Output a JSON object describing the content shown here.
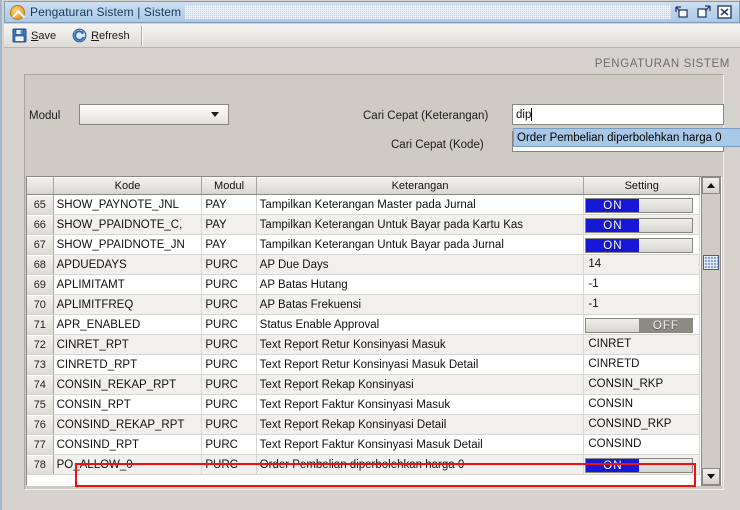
{
  "window": {
    "title": "Pengaturan Sistem | Sistem",
    "icon": "app-chevron-icon",
    "controls": [
      {
        "name": "restore-button",
        "label": "Restore"
      },
      {
        "name": "maximize-button",
        "label": "Maximize"
      },
      {
        "name": "close-button",
        "label": "Close"
      }
    ]
  },
  "toolbar": {
    "items": [
      {
        "name": "save-button",
        "label": "Save",
        "mnemonic": "S",
        "icon": "floppy-disk-icon"
      },
      {
        "name": "refresh-button",
        "label": "Refresh",
        "mnemonic": "R",
        "icon": "refresh-circle-icon"
      }
    ]
  },
  "page": {
    "title": "PENGATURAN SISTEM"
  },
  "form": {
    "modul_label": "Modul",
    "modul_value": "",
    "cari_ket_label": "Cari Cepat (Keterangan)",
    "cari_ket_value": "dip",
    "cari_kode_label": "Cari Cepat (Kode)",
    "cari_kode_value": "",
    "autocomplete_suggestion": "Order Pembelian diperbolehkan harga 0"
  },
  "table": {
    "columns": [
      "Kode",
      "Modul",
      "Keterangan",
      "Setting"
    ],
    "rows": [
      {
        "num": "65",
        "kode": "SHOW_PAYNOTE_JNL",
        "modul": "PAY",
        "keterangan": "Tampilkan Keterangan Master pada Jurnal",
        "setting": "ON",
        "type": "toggle"
      },
      {
        "num": "66",
        "kode": "SHOW_PPAIDNOTE_C,",
        "modul": "PAY",
        "keterangan": "Tampilkan Keterangan Untuk Bayar pada Kartu Kas",
        "setting": "ON",
        "type": "toggle"
      },
      {
        "num": "67",
        "kode": "SHOW_PPAIDNOTE_JN",
        "modul": "PAY",
        "keterangan": "Tampilkan Keterangan Untuk Bayar pada Jurnal",
        "setting": "ON",
        "type": "toggle"
      },
      {
        "num": "68",
        "kode": "APDUEDAYS",
        "modul": "PURC",
        "keterangan": "AP Due Days",
        "setting": "14",
        "type": "text"
      },
      {
        "num": "69",
        "kode": "APLIMITAMT",
        "modul": "PURC",
        "keterangan": "AP Batas Hutang",
        "setting": "-1",
        "type": "text"
      },
      {
        "num": "70",
        "kode": "APLIMITFREQ",
        "modul": "PURC",
        "keterangan": "AP Batas Frekuensi",
        "setting": "-1",
        "type": "text"
      },
      {
        "num": "71",
        "kode": "APR_ENABLED",
        "modul": "PURC",
        "keterangan": "Status Enable Approval",
        "setting": "OFF",
        "type": "toggle-off"
      },
      {
        "num": "72",
        "kode": "CINRET_RPT",
        "modul": "PURC",
        "keterangan": "Text Report Retur Konsinyasi Masuk",
        "setting": "CINRET",
        "type": "text"
      },
      {
        "num": "73",
        "kode": "CINRETD_RPT",
        "modul": "PURC",
        "keterangan": "Text Report Retur Konsinyasi Masuk Detail",
        "setting": "CINRETD",
        "type": "text"
      },
      {
        "num": "74",
        "kode": "CONSIN_REKAP_RPT",
        "modul": "PURC",
        "keterangan": "Text Report Rekap Konsinyasi",
        "setting": "CONSIN_RKP",
        "type": "text"
      },
      {
        "num": "75",
        "kode": "CONSIN_RPT",
        "modul": "PURC",
        "keterangan": "Text Report Faktur Konsinyasi Masuk",
        "setting": "CONSIN",
        "type": "text"
      },
      {
        "num": "76",
        "kode": "CONSIND_REKAP_RPT",
        "modul": "PURC",
        "keterangan": "Text Report Rekap Konsinyasi Detail",
        "setting": "CONSIND_RKP",
        "type": "text"
      },
      {
        "num": "77",
        "kode": "CONSIND_RPT",
        "modul": "PURC",
        "keterangan": "Text Report Faktur Konsinyasi Masuk Detail",
        "setting": "CONSIND",
        "type": "text"
      },
      {
        "num": "78",
        "kode": "PO_ALLOW_0",
        "modul": "PURC",
        "keterangan": "Order Pembelian diperbolehkan harga 0",
        "setting": "ON",
        "type": "toggle",
        "highlighted": true
      }
    ]
  },
  "colors": {
    "titlebar": "#bcd3ec",
    "toggle_on": "#1717d8",
    "toggle_off": "#8d8a84",
    "highlight_rect": "#ee1111",
    "autocomplete_bg": "#a8c8e8",
    "panel_bg": "#cecac4"
  }
}
